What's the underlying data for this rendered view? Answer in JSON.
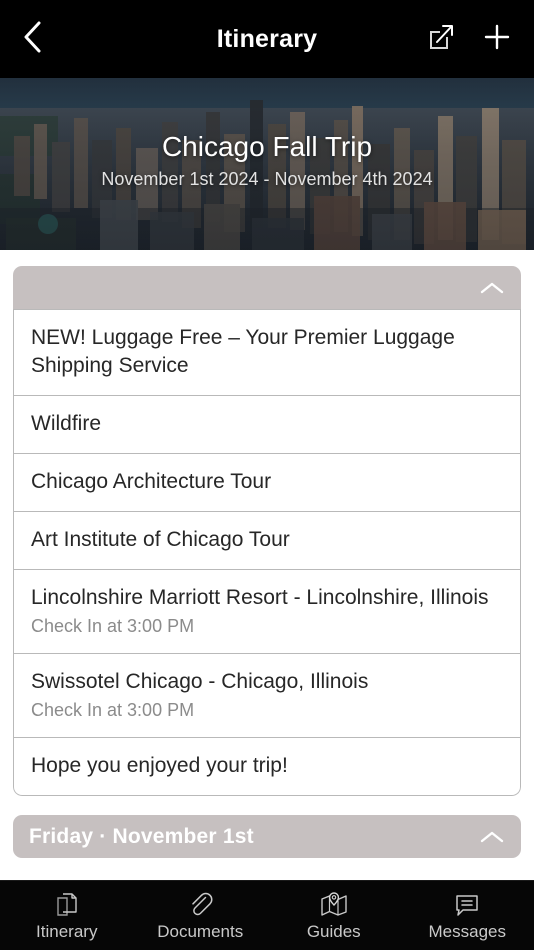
{
  "navbar": {
    "back_icon": "chevron-left-icon",
    "title": "Itinerary",
    "share_icon": "share-export-icon",
    "add_icon": "plus-icon"
  },
  "hero": {
    "image_alt": "chicago-skyline-aerial",
    "title": "Chicago Fall Trip",
    "date_range": "November 1st 2024 - November 4th 2024"
  },
  "cards": [
    {
      "header_label": "",
      "collapse_icon": "chevron-up-icon",
      "rows": [
        {
          "title": "NEW! Luggage Free – Your Premier Luggage Shipping Service",
          "subtitle": ""
        },
        {
          "title": "Wildfire",
          "subtitle": ""
        },
        {
          "title": "Chicago Architecture Tour",
          "subtitle": ""
        },
        {
          "title": "Art Institute of Chicago Tour",
          "subtitle": ""
        },
        {
          "title": "Lincolnshire Marriott Resort - Lincolnshire, Illinois",
          "subtitle": "Check In at 3:00 PM"
        },
        {
          "title": "Swissotel Chicago - Chicago, Illinois",
          "subtitle": "Check In at 3:00 PM"
        },
        {
          "title": "Hope you enjoyed your trip!",
          "subtitle": ""
        }
      ]
    },
    {
      "header_label": "Friday · November 1st",
      "collapse_icon": "chevron-up-icon",
      "rows": []
    }
  ],
  "tabbar": {
    "items": [
      {
        "label": "Itinerary",
        "icon": "documents-pages-icon"
      },
      {
        "label": "Documents",
        "icon": "paperclip-icon"
      },
      {
        "label": "Guides",
        "icon": "map-pin-icon"
      },
      {
        "label": "Messages",
        "icon": "chat-bubble-icon"
      }
    ]
  },
  "colors": {
    "navbar_bg": "#000000",
    "card_header_bg": "#c6c0c0",
    "row_border": "#b9b9b9",
    "row_title": "#272727",
    "row_subtitle": "#8b8b8b",
    "tabbar_bg": "#060606",
    "tab_label": "#c9c9c9"
  }
}
